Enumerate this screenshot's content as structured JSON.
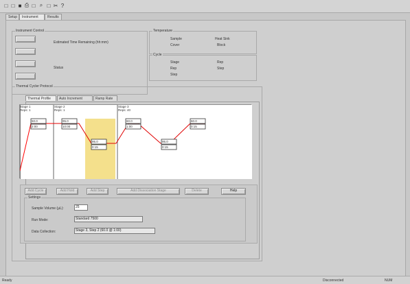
{
  "toolbar": {
    "icons": [
      "new-icon",
      "open-icon",
      "save-icon",
      "print-icon",
      "preview-icon",
      "find-icon",
      "copy-icon",
      "paste-icon",
      "help-icon"
    ],
    "glyphs": [
      "□",
      "□",
      "■",
      "⎙",
      "□",
      "⌕",
      "□",
      "✂",
      "?"
    ]
  },
  "tabs": [
    "Setup",
    "Instrument",
    "Results"
  ],
  "instrument_control": {
    "title": "Instrument Control",
    "estimated_label": "Estimated Time Remaining (hh:mm)",
    "status_label": "Status"
  },
  "temperature": {
    "title": "Temperature",
    "labels": [
      "Sample",
      "Cover"
    ],
    "values": [
      "Heat Sink",
      "Block"
    ]
  },
  "cycle": {
    "title": "Cycle",
    "labels": [
      "Stage",
      "Rep",
      "Step"
    ],
    "values": [
      "Rep",
      "Step"
    ]
  },
  "thermal": {
    "title": "Thermal Cycler Protocol",
    "inner_tabs": [
      "Thermal Profile",
      "Auto Increment",
      "Ramp Rate"
    ],
    "stage_labels": [
      {
        "stage": "Stage 1",
        "reps": "Reps: 1"
      },
      {
        "stage": "Stage 2",
        "reps": "Reps: 1"
      },
      {
        "stage": "Stage 3",
        "reps": "Reps: 40"
      }
    ],
    "temps": [
      "50.0",
      "2:00",
      "95.0",
      "10:00",
      "95.0",
      "0:15",
      "60.0",
      "1:00",
      "95.0",
      "0:15",
      "60.0",
      "0:15"
    ],
    "buttons": [
      "Add Cycle",
      "Add Hold",
      "Add Step",
      "Add Dissociation Stage",
      "Delete",
      "Help"
    ],
    "settings_title": "Settings",
    "settings_labels": [
      "Sample Volume (µL):",
      "Run Mode:",
      "Data Collection:"
    ],
    "settings_values": [
      "25",
      "Standard 7500",
      "Stage 3, Step 2 (60.0 @ 1:00)"
    ]
  },
  "statusbar": {
    "left": "Ready",
    "right": [
      "Disconnected",
      "NUM"
    ]
  }
}
